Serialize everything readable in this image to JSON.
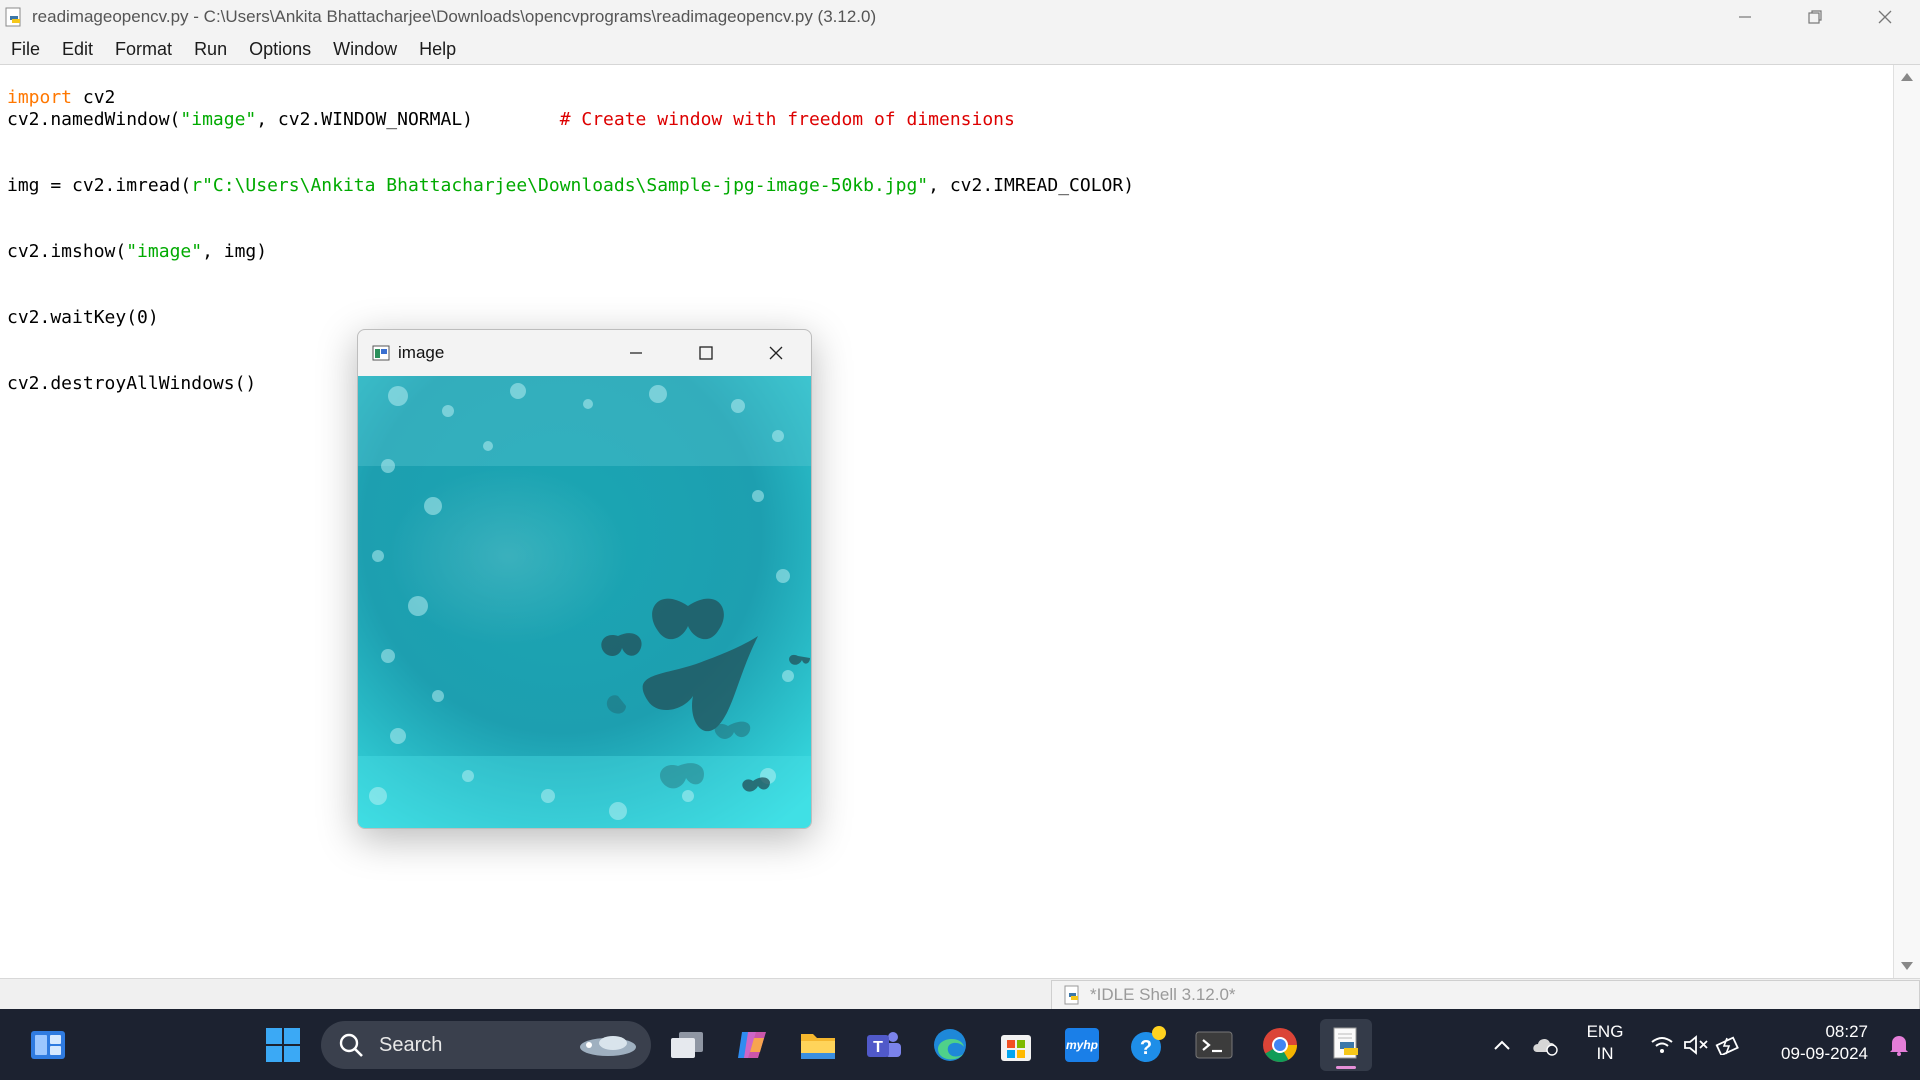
{
  "window": {
    "title": "readimageopencv.py - C:\\Users\\Ankita Bhattacharjee\\Downloads\\opencvprograms\\readimageopencv.py (3.12.0)"
  },
  "menu": [
    "File",
    "Edit",
    "Format",
    "Run",
    "Options",
    "Window",
    "Help"
  ],
  "code": {
    "l1_kw": "import",
    "l1_rest": " cv2",
    "l2_a": "cv2.namedWindow(",
    "l2_str": "\"image\"",
    "l2_b": ", cv2.WINDOW_NORMAL)",
    "l2_gap": "        ",
    "l2_comment": "# Create window with freedom of dimensions",
    "l4_a": "img = cv2.imread(",
    "l4_str": "r\"C:\\Users\\Ankita Bhattacharjee\\Downloads\\Sample-jpg-image-50kb.jpg\"",
    "l4_b": ", cv2.IMREAD_COLOR)",
    "l6_a": "cv2.imshow(",
    "l6_str": "\"image\"",
    "l6_b": ", img)",
    "l8": "cv2.waitKey(0)",
    "l10": "cv2.destroyAllWindows()"
  },
  "shell_tab": {
    "label": "*IDLE Shell 3.12.0*"
  },
  "cv_window": {
    "title": "image"
  },
  "taskbar": {
    "search_label": "Search",
    "language": "ENG",
    "region": "IN",
    "time": "08:27",
    "date": "09-09-2024",
    "myhp_label": "myhp"
  },
  "colors": {
    "keyword": "#ff7700",
    "string": "#00aa00",
    "comment": "#dd0000",
    "taskbar_bg": "#1c2230",
    "image_teal": "#1fb7c4"
  }
}
